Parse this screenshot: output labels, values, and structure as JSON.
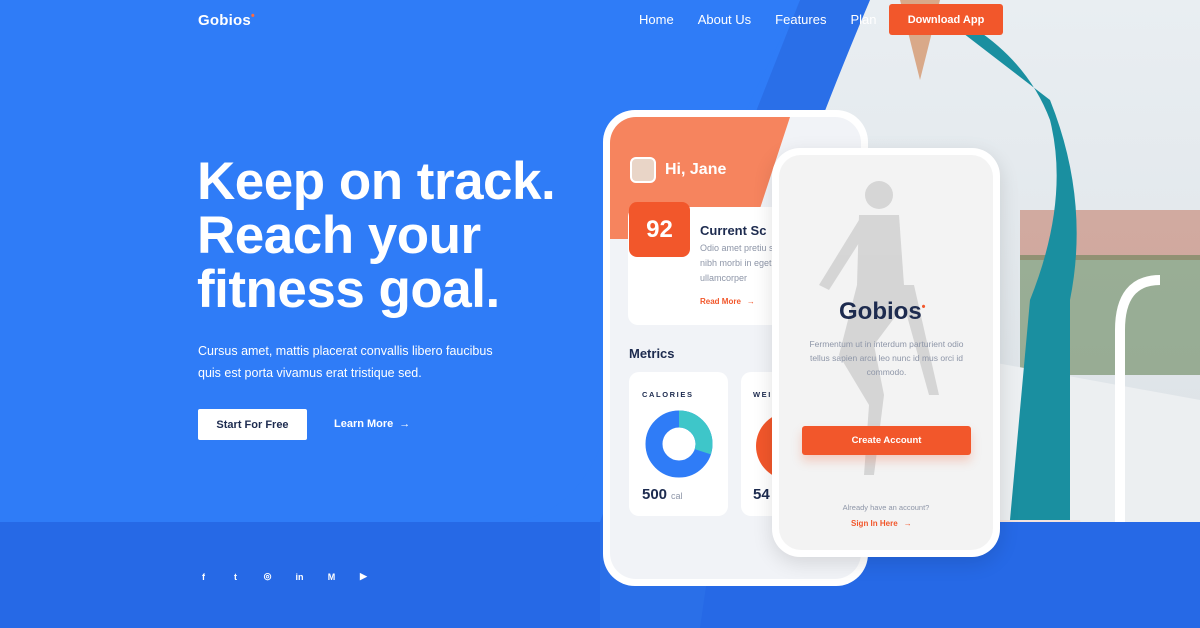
{
  "brand": {
    "name": "Gobios",
    "mark": "•"
  },
  "nav": {
    "items": [
      "Home",
      "About Us",
      "Features",
      "Plan"
    ],
    "cta": "Download App"
  },
  "hero": {
    "title_lines": [
      "Keep on track.",
      "Reach your",
      "fitness goal."
    ],
    "subtitle": "Cursus amet, mattis placerat convallis libero faucibus quis est porta vivamus erat tristique sed.",
    "primary_button": "Start For Free",
    "secondary_button": "Learn More",
    "secondary_arrow": "→"
  },
  "socials": [
    "facebook-icon",
    "twitter-icon",
    "instagram-icon",
    "linkedin-icon",
    "medium-icon",
    "youtube-icon"
  ],
  "social_glyphs": [
    "f",
    "t",
    "◎",
    "in",
    "M",
    "▶"
  ],
  "phone_dashboard": {
    "greeting": "Hi, Jane",
    "score": "92",
    "score_title": "Current Sc",
    "score_text": "Odio amet pretiu sed nibh morbi in eget ullamcorper",
    "read_more": "Read More",
    "arrow": "→",
    "metrics_title": "Metrics",
    "calories_label": "CALORIES",
    "calories_value": "500",
    "calories_unit": "cal",
    "calories_fill": 0.3,
    "weight_label": "WEI",
    "weight_value": "54"
  },
  "phone_signup": {
    "logo": "Gobios",
    "text": "Fermentum ut in interdum parturient odio tellus sapien arcu leo nunc id mus orci id commodo.",
    "create_button": "Create Account",
    "already": "Already have an account?",
    "sign_in": "Sign In Here",
    "arrow": "→"
  },
  "colors": {
    "primary_blue": "#2f7cf7",
    "accent_orange": "#f2572b",
    "dark_text": "#1d2b4f",
    "teal": "#3ec6c9"
  }
}
